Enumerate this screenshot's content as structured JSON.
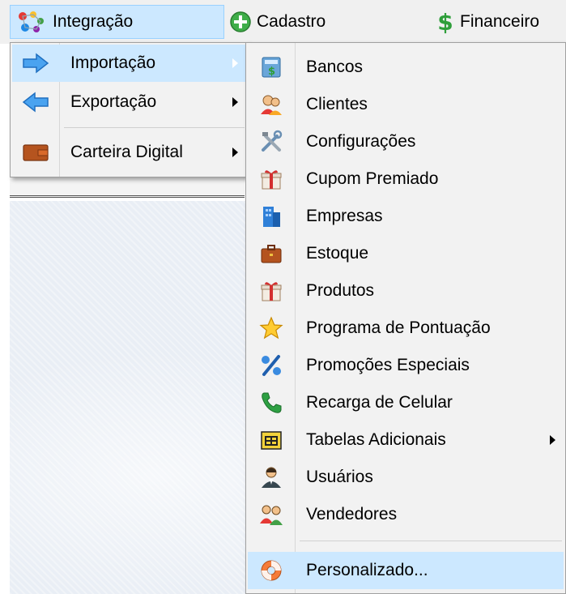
{
  "menubar": {
    "items": [
      {
        "label": "Integração",
        "icon": "integration-dots-icon"
      },
      {
        "label": "Cadastro",
        "icon": "green-plus-icon"
      },
      {
        "label": "Financeiro",
        "icon": "dollar-icon"
      }
    ]
  },
  "integration_menu": {
    "items": [
      {
        "label": "Importação",
        "icon": "blue-arrow-right-icon"
      },
      {
        "label": "Exportação",
        "icon": "blue-arrow-left-icon"
      },
      {
        "label": "Carteira Digital",
        "icon": "wallet-icon"
      }
    ]
  },
  "import_menu": {
    "items": [
      {
        "label": "Bancos",
        "icon": "bank-icon"
      },
      {
        "label": "Clientes",
        "icon": "clients-icon"
      },
      {
        "label": "Configurações",
        "icon": "tools-icon"
      },
      {
        "label": "Cupom Premiado",
        "icon": "gift-icon"
      },
      {
        "label": "Empresas",
        "icon": "building-icon"
      },
      {
        "label": "Estoque",
        "icon": "briefcase-icon"
      },
      {
        "label": "Produtos",
        "icon": "gift-icon"
      },
      {
        "label": "Programa de Pontuação",
        "icon": "star-icon"
      },
      {
        "label": "Promoções Especiais",
        "icon": "percent-icon"
      },
      {
        "label": "Recarga de Celular",
        "icon": "phone-icon"
      },
      {
        "label": "Tabelas Adicionais",
        "icon": "table-icon"
      },
      {
        "label": "Usuários",
        "icon": "user-icon"
      },
      {
        "label": "Vendedores",
        "icon": "sellers-icon"
      },
      {
        "label": "Personalizado...",
        "icon": "lifebuoy-icon"
      }
    ]
  },
  "colors": {
    "highlight": "#cce8ff",
    "highlight_border": "#99d1ff",
    "menu_bg": "#f2f2f2",
    "menubar_bg": "#f0f0f0"
  }
}
